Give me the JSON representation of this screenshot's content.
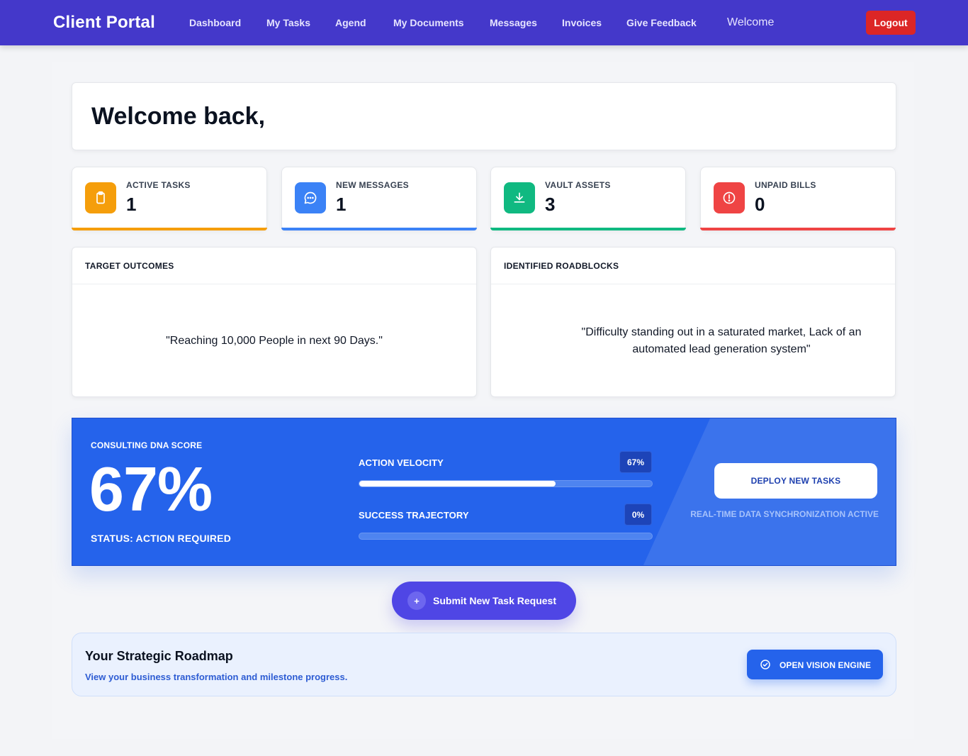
{
  "nav": {
    "brand": "Client Portal",
    "links": [
      "Dashboard",
      "My Tasks",
      "Agend",
      "My Documents",
      "Messages",
      "Invoices",
      "Give Feedback"
    ],
    "welcome": "Welcome",
    "logout": "Logout"
  },
  "welcome": {
    "title": "Welcome back,"
  },
  "stats": [
    {
      "label": "ACTIVE TASKS",
      "value": "1",
      "color": "#f59e0b",
      "icon": "clipboard-icon"
    },
    {
      "label": "NEW MESSAGES",
      "value": "1",
      "color": "#3b82f6",
      "icon": "chat-bubble-icon"
    },
    {
      "label": "VAULT ASSETS",
      "value": "3",
      "color": "#10b981",
      "icon": "download-icon"
    },
    {
      "label": "UNPAID BILLS",
      "value": "0",
      "color": "#ef4444",
      "icon": "alert-circle-icon"
    }
  ],
  "panels": {
    "outcomes": {
      "title": "TARGET OUTCOMES",
      "text": "\"Reaching 10,000 People in next 90 Days.\""
    },
    "roadblocks": {
      "title": "IDENTIFIED ROADBLOCKS",
      "text": "\"Difficulty standing out in a saturated market, Lack of an automated lead generation system\""
    }
  },
  "dna": {
    "label": "CONSULTING DNA SCORE",
    "score": "67%",
    "status": "STATUS: ACTION REQUIRED",
    "metrics": [
      {
        "label": "ACTION VELOCITY",
        "badge": "67%",
        "progress": 0.67
      },
      {
        "label": "SUCCESS TRAJECTORY",
        "badge": "0%",
        "progress": 0
      }
    ],
    "deploy": "DEPLOY NEW TASKS",
    "sync": "REAL-TIME DATA SYNCHRONIZATION ACTIVE",
    "color": "#2563eb"
  },
  "submit": {
    "icon": "+",
    "label": "Submit New Task Request"
  },
  "roadmap": {
    "title": "Your Strategic Roadmap",
    "subtitle": "View your business transformation and milestone progress.",
    "button": "OPEN VISION ENGINE",
    "button_icon": "check-circle-icon"
  }
}
